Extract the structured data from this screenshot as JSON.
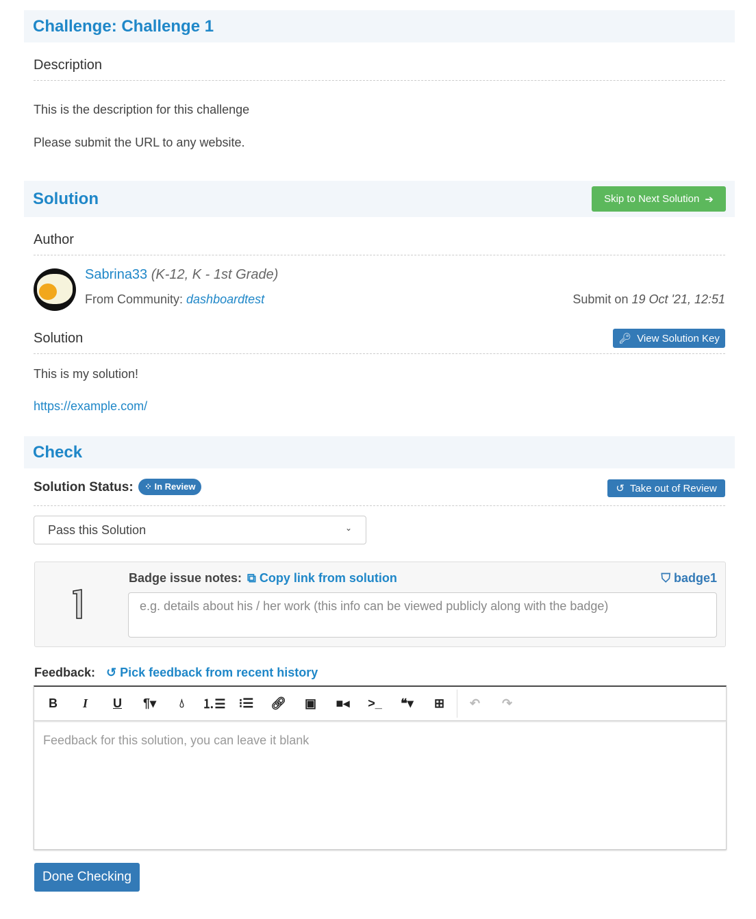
{
  "challenge": {
    "title": "Challenge: Challenge 1",
    "description_heading": "Description",
    "description": "This is the description for this challenge",
    "instruction": "Please submit the URL to any website."
  },
  "solution": {
    "title": "Solution",
    "skip_label": "Skip to Next Solution",
    "author_heading": "Author",
    "author_name": "Sabrina33",
    "author_grade": "(K-12, K - 1st Grade)",
    "community_label": "From Community:",
    "community": "dashboardtest",
    "submit_label": "Submit on",
    "submit_date": "19 Oct '21, 12:51",
    "solution_heading": "Solution",
    "view_key_label": "View Solution Key",
    "solution_text": "This is my solution!",
    "solution_url": "https://example.com/"
  },
  "check": {
    "title": "Check",
    "status_label": "Solution Status:",
    "status": "In Review",
    "take_out_label": "Take out of Review",
    "select_value": "Pass this Solution",
    "badge_notes_label": "Badge issue notes:",
    "copy_link_label": "Copy link from solution",
    "badge_name": "badge1",
    "badge_notes_placeholder": "e.g. details about his / her work (this info can be viewed publicly along with the badge)",
    "feedback_label": "Feedback:",
    "pick_feedback_label": "Pick feedback from recent history",
    "feedback_placeholder": "Feedback for this solution, you can leave it blank",
    "done_label": "Done Checking"
  },
  "colors": {
    "primary": "#337ab7",
    "accent": "#1f87c8",
    "success": "#5cb85c"
  },
  "toolbar": [
    "bold-icon",
    "italic-icon",
    "underline-icon",
    "paragraph-icon",
    "color-drop-icon",
    "ordered-list-icon",
    "unordered-list-icon",
    "link-icon",
    "image-icon",
    "video-icon",
    "code-icon",
    "quote-icon",
    "table-icon",
    "undo-icon",
    "redo-icon"
  ]
}
